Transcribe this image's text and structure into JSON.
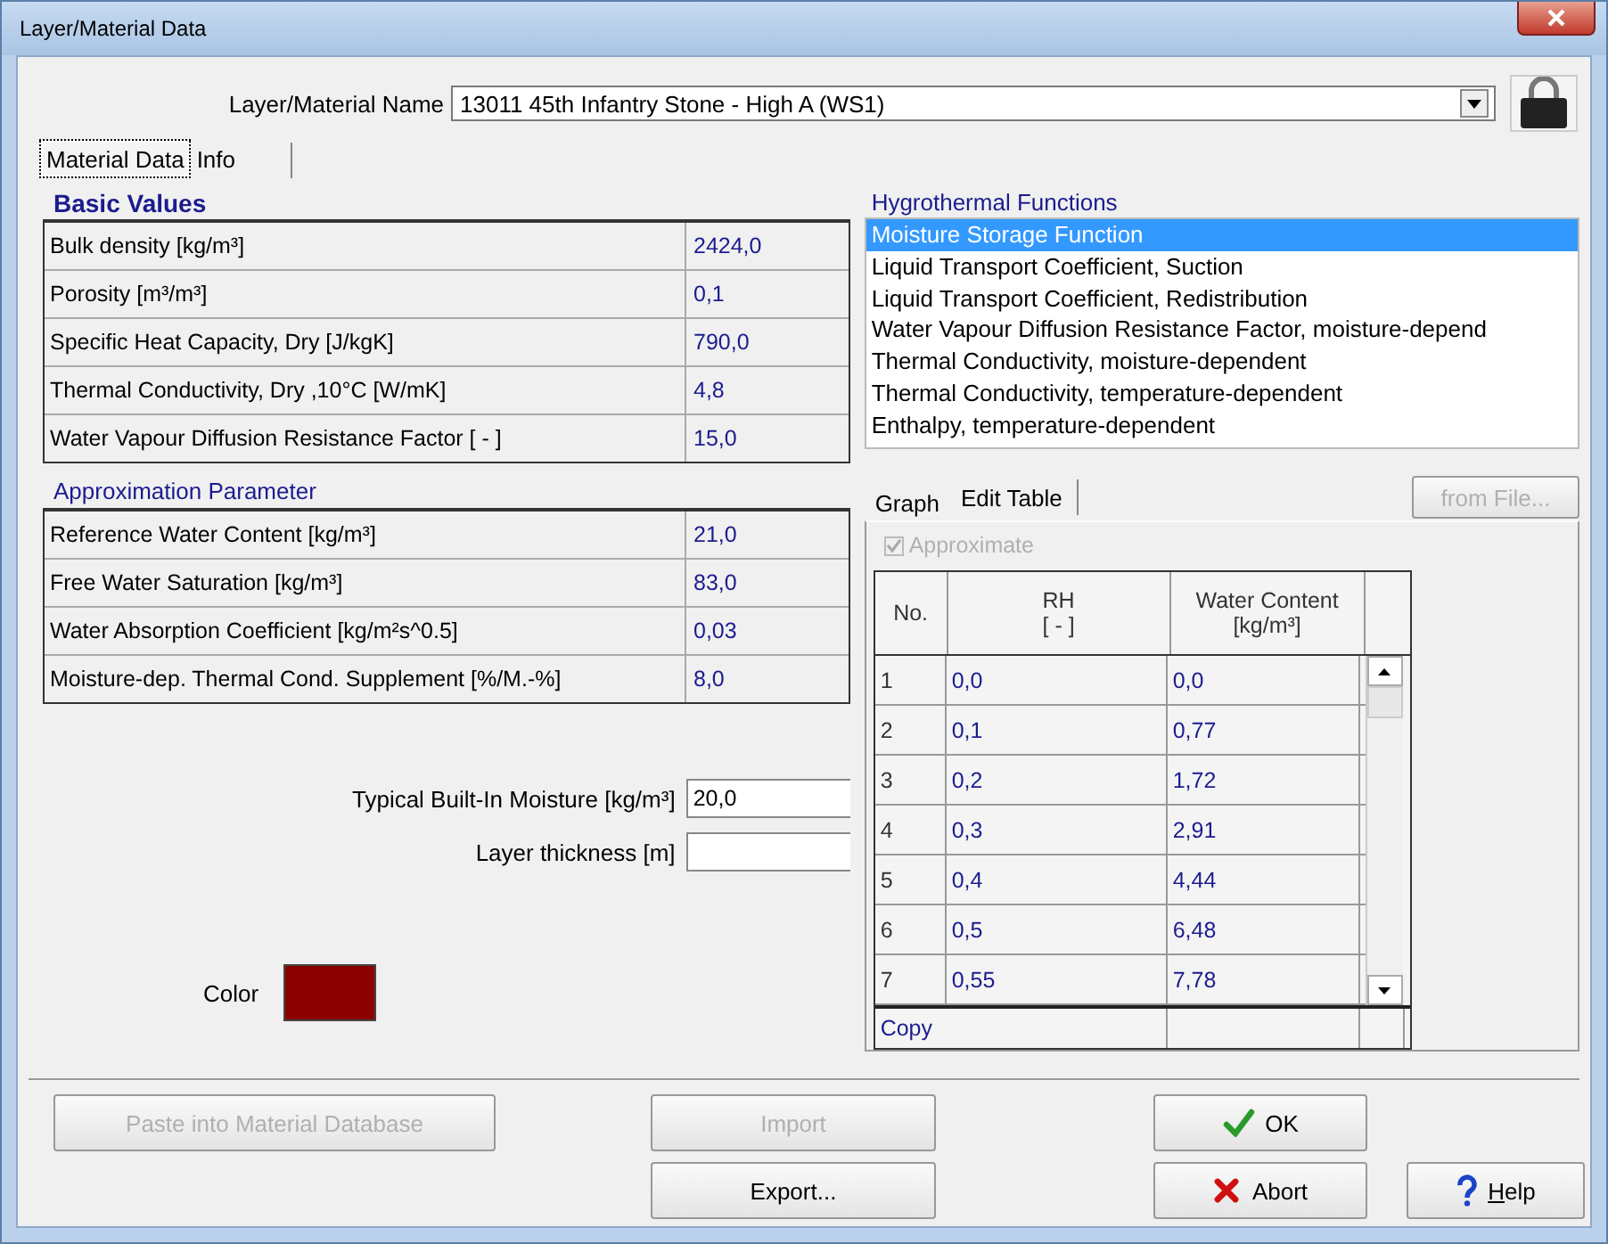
{
  "window": {
    "title": "Layer/Material Data"
  },
  "name_field": {
    "label": "Layer/Material Name",
    "value": "13011 45th Infantry Stone  - High A (WS1)"
  },
  "tabs": [
    {
      "label": "Material Data",
      "selected": true
    },
    {
      "label": "Info",
      "selected": false
    }
  ],
  "groups": [
    {
      "title": "Basic Values",
      "bold": true,
      "rows": [
        {
          "label": "Bulk density [kg/m³]",
          "value": "2424,0"
        },
        {
          "label": "Porosity [m³/m³]",
          "value": "0,1"
        },
        {
          "label": "Specific Heat Capacity, Dry [J/kgK]",
          "value": "790,0"
        },
        {
          "label": "Thermal Conductivity, Dry ,10°C [W/mK]",
          "value": "4,8"
        },
        {
          "label": "Water Vapour Diffusion Resistance Factor [ - ]",
          "value": "15,0"
        }
      ]
    },
    {
      "title": "Approximation Parameter",
      "bold": false,
      "rows": [
        {
          "label": "Reference Water Content [kg/m³]",
          "value": "21,0"
        },
        {
          "label": "Free Water Saturation [kg/m³]",
          "value": "83,0"
        },
        {
          "label": "Water Absorption Coefficient [kg/m²s^0.5]",
          "value": "0,03"
        },
        {
          "label": "Moisture-dep. Thermal Cond. Supplement [%/M.-%]",
          "value": "8,0"
        }
      ]
    }
  ],
  "fields": [
    {
      "label": "Typical Built-In Moisture [kg/m³]",
      "value": "20,0"
    },
    {
      "label": "Layer thickness [m]"
    }
  ],
  "color_swatch": {
    "label": "Color",
    "color": "#8b0000"
  },
  "functions": {
    "title": "Hygrothermal Functions",
    "items": [
      {
        "label": "Moisture Storage Function",
        "selected": true
      },
      {
        "label": "Liquid Transport Coefficient, Suction",
        "selected": false
      },
      {
        "label": "Liquid Transport Coefficient, Redistribution",
        "selected": false
      },
      {
        "label": "Water Vapour Diffusion Resistance Factor, moisture-depend",
        "selected": false
      },
      {
        "label": "Thermal Conductivity, moisture-dependent",
        "selected": false
      },
      {
        "label": "Thermal Conductivity, temperature-dependent",
        "selected": false
      },
      {
        "label": "Enthalpy, temperature-dependent",
        "selected": false
      }
    ]
  },
  "sub_tabs": [
    {
      "label": "Graph",
      "selected": false
    },
    {
      "label": "Edit Table",
      "selected": true
    }
  ],
  "from_file_button": {
    "label": "from File...",
    "disabled": true
  },
  "approximate": {
    "label": "Approximate",
    "checked": true,
    "disabled": true
  },
  "table": {
    "columns": [
      {
        "label": "No."
      },
      {
        "label": "RH",
        "unit": "[ - ]"
      },
      {
        "label": "Water Content",
        "unit": "[kg/m³]"
      }
    ],
    "rows": [
      [
        "1",
        "0,0",
        "0,0"
      ],
      [
        "2",
        "0,1",
        "0,77"
      ],
      [
        "3",
        "0,2",
        "1,72"
      ],
      [
        "4",
        "0,3",
        "2,91"
      ],
      [
        "5",
        "0,4",
        "4,44"
      ],
      [
        "6",
        "0,5",
        "6,48"
      ],
      [
        "7",
        "0,55",
        "7,78"
      ]
    ],
    "footer": "Copy"
  },
  "buttons": [
    {
      "label": "Paste into Material Database",
      "kind": "plain",
      "disabled": true
    },
    {
      "label": "Import",
      "kind": "plain",
      "disabled": true
    },
    {
      "label": "OK",
      "kind": "ok",
      "disabled": false
    },
    {
      "label": "Export...",
      "kind": "plain",
      "disabled": false
    },
    {
      "label": "Abort",
      "kind": "abort",
      "disabled": false
    },
    {
      "label": "Help",
      "kind": "help",
      "disabled": false
    }
  ]
}
